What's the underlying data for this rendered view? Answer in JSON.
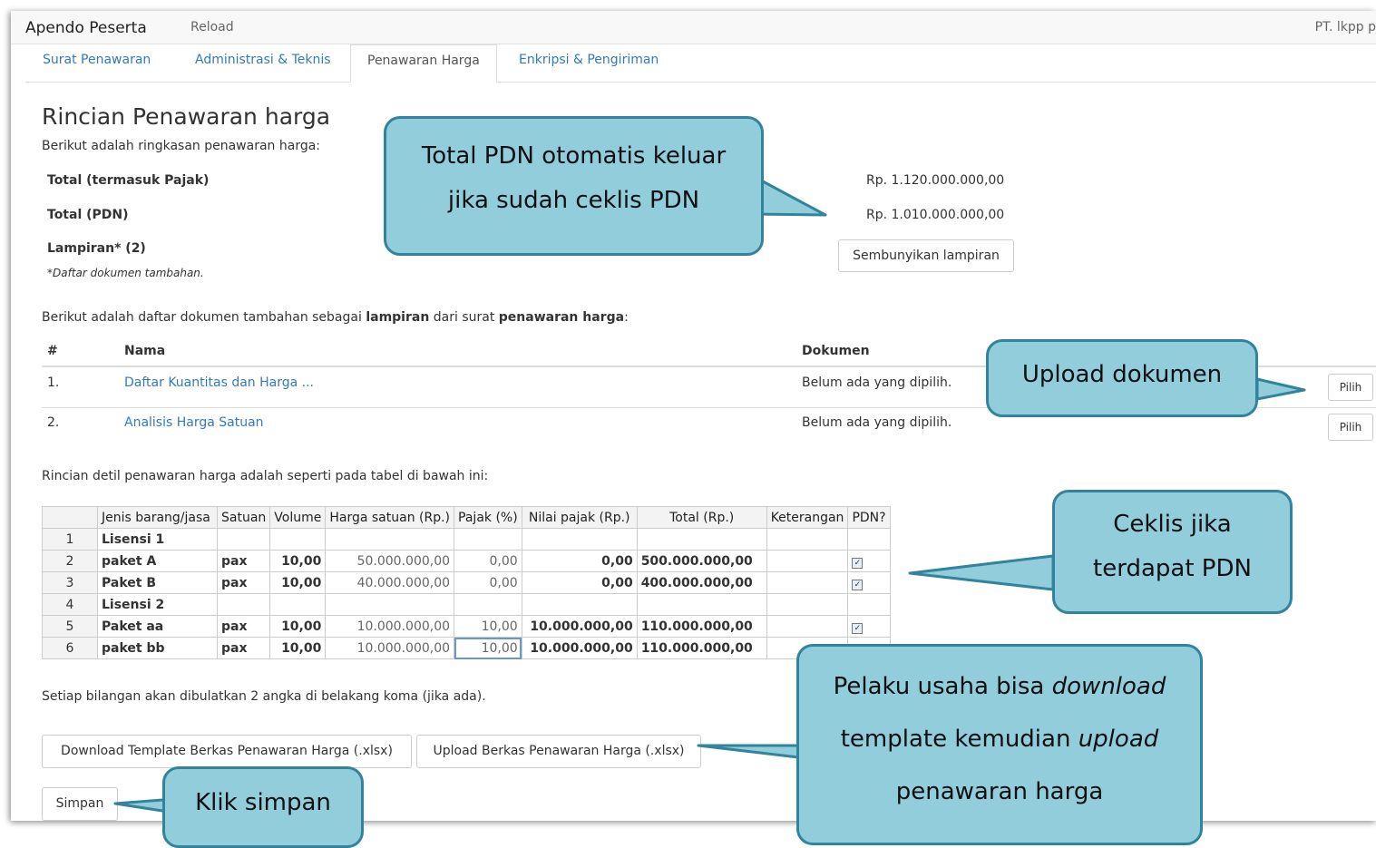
{
  "topbar": {
    "app_title": "Apendo Peserta",
    "reload": "Reload",
    "user": "PT. lkpp p"
  },
  "tabs": [
    "Surat Penawaran",
    "Administrasi & Teknis",
    "Penawaran Harga",
    "Enkripsi & Pengiriman"
  ],
  "summary": {
    "title": "Rincian Penawaran harga",
    "intro": "Berikut adalah ringkasan penawaran harga:",
    "total_pajak_label": "Total (termasuk Pajak)",
    "total_pajak_value": "Rp. 1.120.000.000,00",
    "total_pdn_label": "Total (PDN)",
    "total_pdn_value": "Rp. 1.010.000.000,00",
    "lampiran_label": "Lampiran* (2)",
    "lampiran_note": "*Daftar dokumen tambahan.",
    "hide_button": "Sembunyikan lampiran"
  },
  "lampiran": {
    "intro_pre": "Berikut adalah daftar dokumen tambahan sebagai ",
    "intro_b1": "lampiran",
    "intro_mid": " dari surat ",
    "intro_b2": "penawaran harga",
    "intro_post": ":",
    "col_no": "#",
    "col_nama": "Nama",
    "col_dokumen": "Dokumen",
    "rows": [
      {
        "no": "1.",
        "nama": "Daftar Kuantitas dan Harga ...",
        "dokumen": "Belum ada yang dipilih.",
        "button": "Pilih"
      },
      {
        "no": "2.",
        "nama": "Analisis Harga Satuan",
        "dokumen": "Belum ada yang dipilih.",
        "button": "Pilih"
      }
    ]
  },
  "detail": {
    "intro": "Rincian detil penawaran harga adalah seperti pada tabel di bawah ini:",
    "headers": [
      "Jenis barang/jasa",
      "Satuan",
      "Volume",
      "Harga satuan (Rp.)",
      "Pajak (%)",
      "Nilai pajak (Rp.)",
      "Total (Rp.)",
      "Keterangan",
      "PDN?"
    ],
    "rows": [
      {
        "n": "1",
        "jenis": "Lisensi 1",
        "satuan": "",
        "volume": "",
        "harga": "",
        "pajak": "",
        "nilai": "",
        "total": "",
        "ket": "",
        "pdn": false
      },
      {
        "n": "2",
        "jenis": "paket A",
        "satuan": "pax",
        "volume": "10,00",
        "harga": "50.000.000,00",
        "pajak": "0,00",
        "nilai": "0,00",
        "total": "500.000.000,00",
        "ket": "",
        "pdn": true
      },
      {
        "n": "3",
        "jenis": "Paket B",
        "satuan": "pax",
        "volume": "10,00",
        "harga": "40.000.000,00",
        "pajak": "0,00",
        "nilai": "0,00",
        "total": "400.000.000,00",
        "ket": "",
        "pdn": true
      },
      {
        "n": "4",
        "jenis": "Lisensi 2",
        "satuan": "",
        "volume": "",
        "harga": "",
        "pajak": "",
        "nilai": "",
        "total": "",
        "ket": "",
        "pdn": false
      },
      {
        "n": "5",
        "jenis": "Paket aa",
        "satuan": "pax",
        "volume": "10,00",
        "harga": "10.000.000,00",
        "pajak": "10,00",
        "nilai": "10.000.000,00",
        "total": "110.000.000,00",
        "ket": "",
        "pdn": true
      },
      {
        "n": "6",
        "jenis": "paket bb",
        "satuan": "pax",
        "volume": "10,00",
        "harga": "10.000.000,00",
        "pajak": "10,00",
        "nilai": "10.000.000,00",
        "total": "110.000.000,00",
        "ket": "",
        "pdn": false
      }
    ],
    "rounding_note": "Setiap bilangan akan dibulatkan 2 angka di belakang koma (jika ada).",
    "download_button": "Download Template Berkas Penawaran Harga (.xlsx)",
    "upload_button": "Upload Berkas Penawaran Harga (.xlsx)",
    "save_button": "Simpan"
  },
  "callouts": {
    "pdn_line1": "Total PDN otomatis keluar",
    "pdn_line2": "jika sudah ceklis PDN",
    "upload_doc": "Upload dokumen",
    "ceklis_line1": "Ceklis jika",
    "ceklis_line2": "terdapat  PDN",
    "pelaku_l1_pre": "Pelaku usaha bisa ",
    "pelaku_l1_em": "download",
    "pelaku_l2_pre": "template kemudian ",
    "pelaku_l2_em": "upload",
    "pelaku_l3": "penawaran harga",
    "simpan": "Klik simpan"
  },
  "colors": {
    "callout_fill": "#92cddc",
    "callout_border": "#31849b",
    "link": "#337ab7"
  }
}
